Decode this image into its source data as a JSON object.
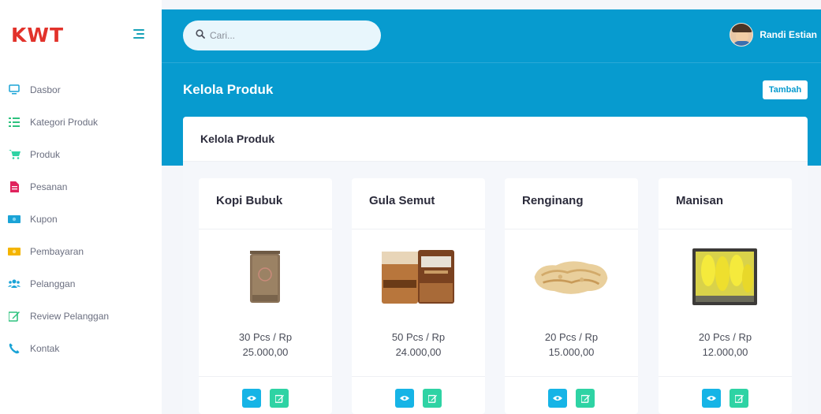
{
  "brand": {
    "name": "KWT",
    "color": "#e2322b"
  },
  "colors": {
    "primary": "#079bcf",
    "success": "#2ed3a4",
    "info": "#16b4e6"
  },
  "sidebar": {
    "items": [
      {
        "label": "Dasbor",
        "icon": "monitor-icon"
      },
      {
        "label": "Kategori Produk",
        "icon": "list-icon"
      },
      {
        "label": "Produk",
        "icon": "cart-icon"
      },
      {
        "label": "Pesanan",
        "icon": "document-icon"
      },
      {
        "label": "Kupon",
        "icon": "ticket-icon"
      },
      {
        "label": "Pembayaran",
        "icon": "money-icon"
      },
      {
        "label": "Pelanggan",
        "icon": "users-icon"
      },
      {
        "label": "Review Pelanggan",
        "icon": "edit-icon"
      },
      {
        "label": "Kontak",
        "icon": "phone-icon"
      }
    ]
  },
  "topbar": {
    "search_placeholder": "Cari...",
    "user_name": "Randi Estian"
  },
  "header": {
    "title": "Kelola Produk",
    "add_button": "Tambah"
  },
  "card": {
    "title": "Kelola Produk"
  },
  "products": [
    {
      "name": "Kopi Bubuk",
      "price_line1": "30 Pcs / Rp",
      "price_line2": "25.000,00",
      "image": "coffee-bag-image"
    },
    {
      "name": "Gula Semut",
      "price_line1": "50 Pcs / Rp",
      "price_line2": "24.000,00",
      "image": "sugar-pouch-image"
    },
    {
      "name": "Renginang",
      "price_line1": "20 Pcs / Rp",
      "price_line2": "15.000,00",
      "image": "rice-cracker-image"
    },
    {
      "name": "Manisan",
      "price_line1": "20 Pcs / Rp",
      "price_line2": "12.000,00",
      "image": "candied-fruit-image"
    }
  ]
}
